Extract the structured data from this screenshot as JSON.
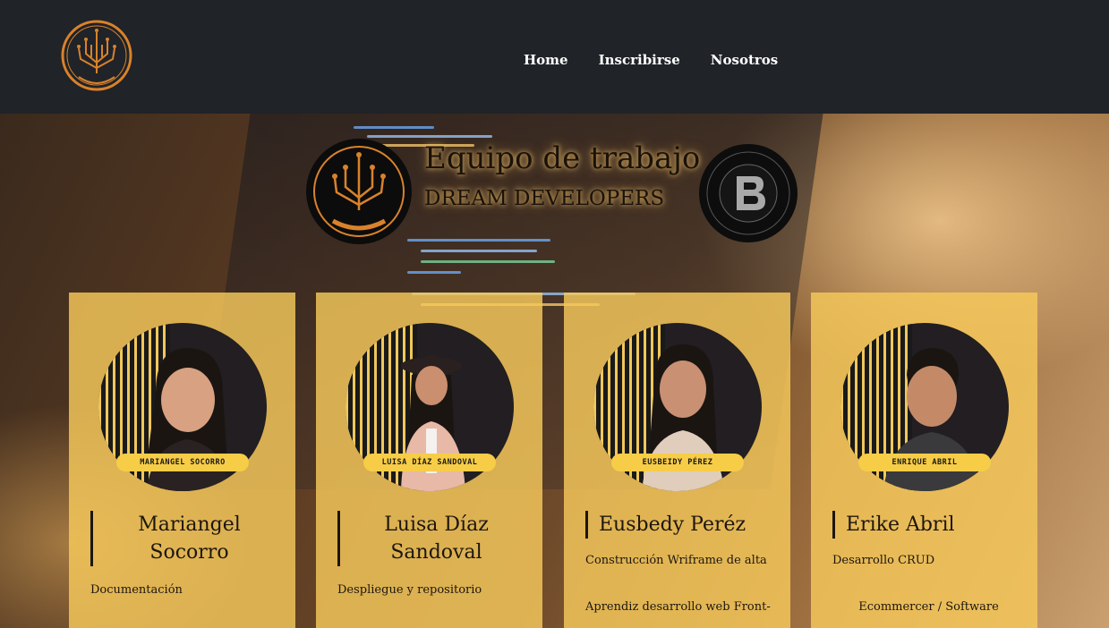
{
  "nav": {
    "links": [
      "Home",
      "Inscribirse",
      "Nosotros"
    ]
  },
  "hero": {
    "title": "Equipo de trabajo",
    "subtitle": "DREAM DEVELOPERS"
  },
  "colors": {
    "card": "#f6c95c",
    "nav_bg": "#202328",
    "tag": "#f7cd47",
    "accent_orange": "#d9822b"
  },
  "team": [
    {
      "tag": "MARIANGEL SOCORRO",
      "name": "Mariangel Socorro",
      "role": "Documentación",
      "extra": ""
    },
    {
      "tag": "LUISA DÍAZ SANDOVAL",
      "name": "Luisa Díaz Sandoval",
      "role": "Despliegue y repositorio",
      "extra": ""
    },
    {
      "tag": "EUSBEIDY PÉREZ",
      "name": "Eusbedy Peréz",
      "role": "Construcción Wriframe de alta",
      "extra": "Aprendiz desarrollo web Front-"
    },
    {
      "tag": "ENRIQUE ABRIL",
      "name": "Erike Abril",
      "role": "Desarrollo CRUD",
      "extra": "Ecommercer / Software"
    }
  ]
}
